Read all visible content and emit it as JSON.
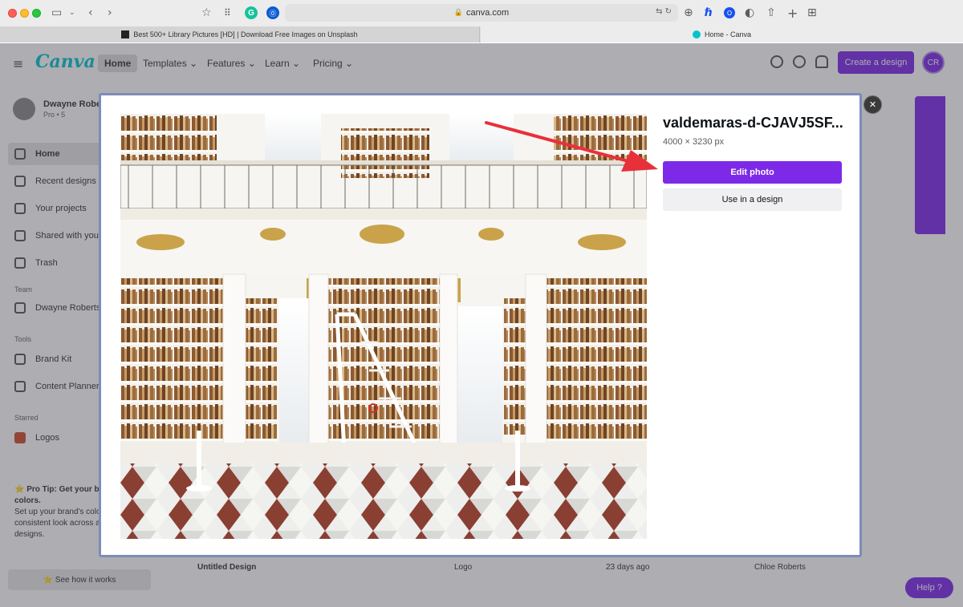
{
  "browser": {
    "url": "canva.com",
    "tabs": [
      {
        "label": "Best 500+ Library Pictures [HD] | Download Free Images on Unsplash",
        "active": false
      },
      {
        "label": "Home - Canva",
        "active": true
      }
    ]
  },
  "canva": {
    "logo": "Canva",
    "nav": [
      "Home",
      "Templates ⌄",
      "Features ⌄",
      "Learn ⌄",
      "Pricing ⌄"
    ],
    "create_button": "Create a design",
    "avatar_initials": "CR",
    "profile": {
      "name": "Dwayne Robe…",
      "subtitle": "Pro • 5"
    },
    "sidebar": [
      {
        "label": "Home",
        "active": true
      },
      {
        "label": "Recent designs"
      },
      {
        "label": "Your projects"
      },
      {
        "label": "Shared with you"
      },
      {
        "label": "Trash"
      }
    ],
    "sidebar_heads": [
      "Team",
      "Tools",
      "Starred"
    ],
    "team_item": "Dwayne Roberts' Te…",
    "tools_items": [
      "Brand Kit",
      "Content Planner"
    ],
    "starred_item": "Logos",
    "tip_title": "⭐ Pro Tip: Get your brand's colors.",
    "tip_body": "Set up your brand's colors to keep a consistent look across all your designs.",
    "tip_button": "⭐ See how it works",
    "help": "Help ?",
    "row": {
      "name": "Untitled Design",
      "type": "Logo",
      "edited": "23 days ago",
      "owner": "Chloe Roberts"
    }
  },
  "modal": {
    "title": "valdemaras-d-CJAVJ5SF...",
    "dimensions": "4000 × 3230 px",
    "edit_label": "Edit photo",
    "use_label": "Use in a design",
    "close_label": "✕"
  },
  "colors": {
    "accent": "#7d2ae8",
    "arrow": "#e8303a",
    "teal": "#00c4cc"
  }
}
